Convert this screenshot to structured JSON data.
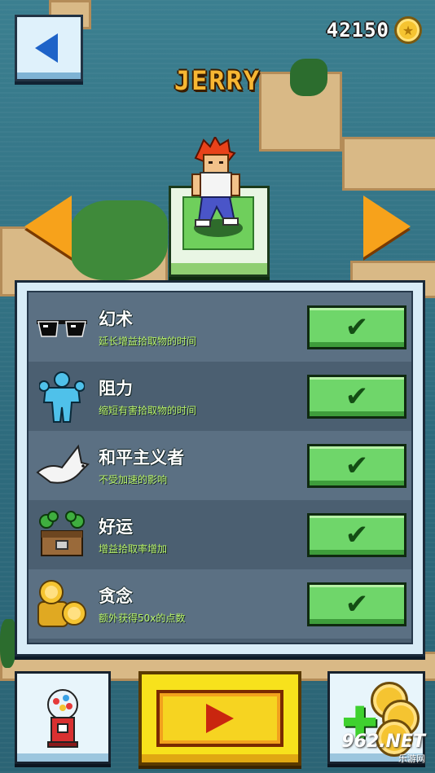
{
  "header": {
    "coins": "42150",
    "character_name": "JERRY"
  },
  "icons": {
    "back": "back-arrow-icon",
    "coin": "coin-icon",
    "prev": "left-arrow-icon",
    "next": "right-arrow-icon",
    "play": "play-icon",
    "gumball": "gumball-machine-icon",
    "shop": "add-coins-icon"
  },
  "perks": [
    {
      "icon": "sunglasses-icon",
      "title": "幻术",
      "desc": "延长增益拾取物的时间",
      "owned": true
    },
    {
      "icon": "strongman-icon",
      "title": "阻力",
      "desc": "缩短有害拾取物的时间",
      "owned": true
    },
    {
      "icon": "dove-icon",
      "title": "和平主义者",
      "desc": "不受加速的影响",
      "owned": true
    },
    {
      "icon": "lucky-chest-icon",
      "title": "好运",
      "desc": "增益拾取率增加",
      "owned": true
    },
    {
      "icon": "coin-stack-icon",
      "title": "贪念",
      "desc": "额外获得50x的点数",
      "owned": true
    }
  ],
  "watermark": {
    "main": "962.NET",
    "sub": "乐游网"
  },
  "colors": {
    "accent_orange": "#f7a21b",
    "check_green": "#6fd66a",
    "play_yellow": "#f7e21c",
    "desc_green": "#b9f36a"
  }
}
